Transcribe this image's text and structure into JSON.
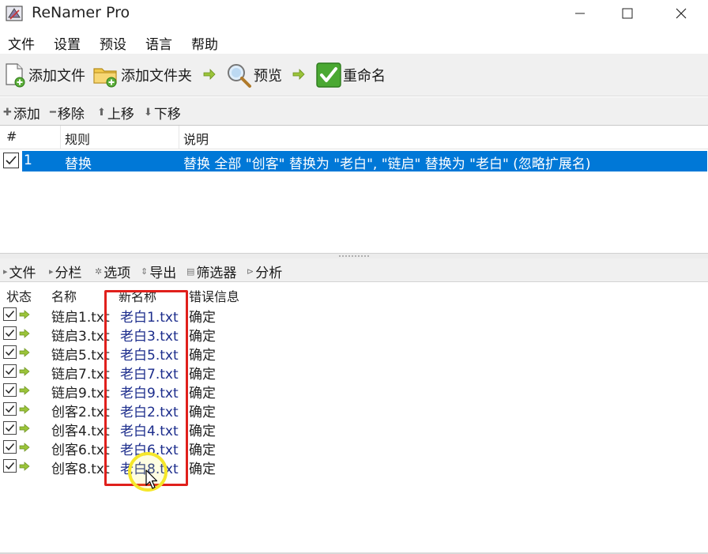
{
  "window": {
    "title": "ReNamer Pro",
    "minimize_glyph": "—",
    "maximize_glyph": "☐",
    "close_glyph": "✕"
  },
  "menu": {
    "items": [
      "文件",
      "设置",
      "预设",
      "语言",
      "帮助"
    ]
  },
  "toolbar": {
    "add_files": "添加文件",
    "add_folder": "添加文件夹",
    "preview": "预览",
    "rename": "重命名"
  },
  "rules_toolbar": {
    "add": "添加",
    "remove": "移除",
    "move_up": "上移",
    "move_down": "下移"
  },
  "rules_table": {
    "columns": [
      "#",
      "规则",
      "说明"
    ],
    "rows": [
      {
        "index": "1",
        "rule": "替换",
        "description": "替换 全部 \"创客\" 替换为 \"老白\", \"链启\" 替换为 \"老白\" (忽略扩展名)"
      }
    ]
  },
  "files_toolbar": {
    "files": "文件",
    "columns": "分栏",
    "options": "选项",
    "export": "导出",
    "filter": "筛选器",
    "analyze": "分析"
  },
  "files_table": {
    "columns": [
      "状态",
      "名称",
      "新名称",
      "错误信息"
    ],
    "rows": [
      {
        "name": "链启1.txt",
        "new_name": "老白1.txt",
        "error": "确定"
      },
      {
        "name": "链启3.txt",
        "new_name": "老白3.txt",
        "error": "确定"
      },
      {
        "name": "链启5.txt",
        "new_name": "老白5.txt",
        "error": "确定"
      },
      {
        "name": "链启7.txt",
        "new_name": "老白7.txt",
        "error": "确定"
      },
      {
        "name": "链启9.txt",
        "new_name": "老白9.txt",
        "error": "确定"
      },
      {
        "name": "创客2.txt",
        "new_name": "老白2.txt",
        "error": "确定"
      },
      {
        "name": "创客4.txt",
        "new_name": "老白4.txt",
        "error": "确定"
      },
      {
        "name": "创客6.txt",
        "new_name": "老白6.txt",
        "error": "确定"
      },
      {
        "name": "创客8.txt",
        "new_name": "老白8.txt",
        "error": "确定"
      }
    ]
  },
  "colors": {
    "selection": "#0078d7",
    "new_name_text": "#1c2d8c",
    "annotation_red": "#e0201c",
    "cursor_highlight": "#f5e72a",
    "arrow_green": "#8ab61e"
  }
}
